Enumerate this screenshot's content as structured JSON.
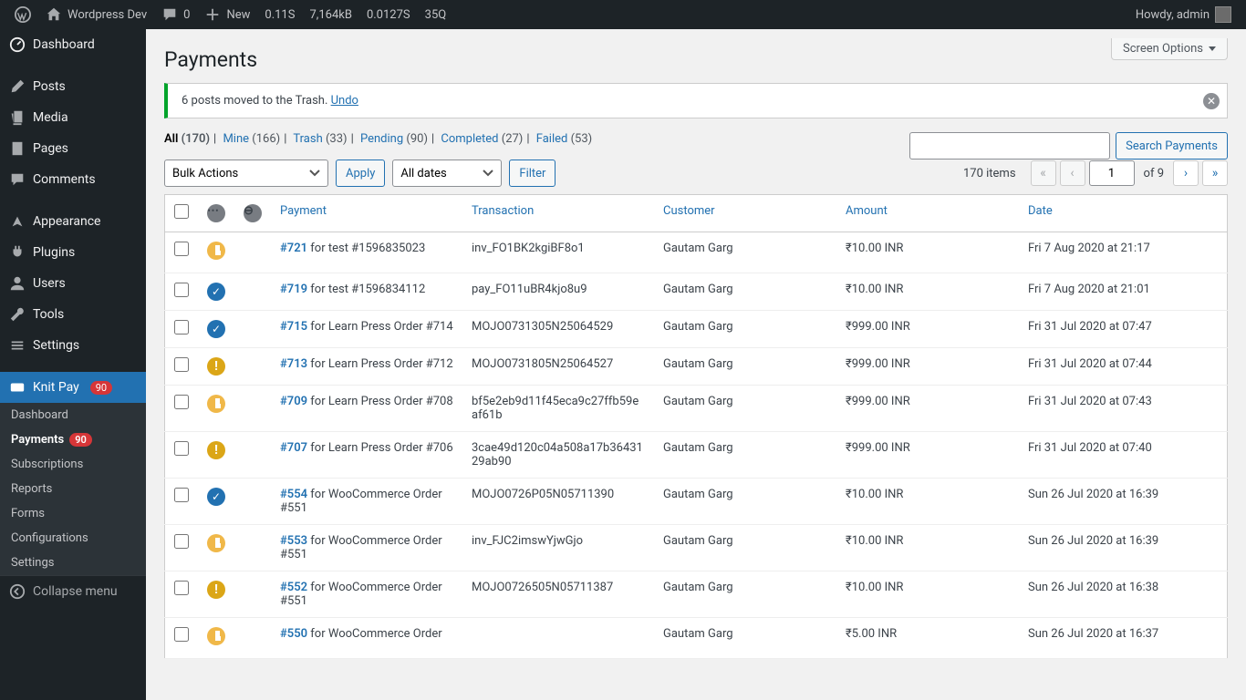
{
  "adminbar": {
    "site": "Wordpress Dev",
    "comments": "0",
    "new": "New",
    "perf1": "0.11S",
    "perf2": "7,164kB",
    "perf3": "0.0127S",
    "perf4": "35Q",
    "howdy": "Howdy, admin"
  },
  "sidebar": {
    "dashboard": "Dashboard",
    "posts": "Posts",
    "media": "Media",
    "pages": "Pages",
    "comments": "Comments",
    "appearance": "Appearance",
    "plugins": "Plugins",
    "users": "Users",
    "tools": "Tools",
    "settings": "Settings",
    "knitpay": "Knit Pay",
    "knitpay_badge": "90",
    "sub": {
      "dashboard": "Dashboard",
      "payments": "Payments",
      "payments_badge": "90",
      "subscriptions": "Subscriptions",
      "reports": "Reports",
      "forms": "Forms",
      "configurations": "Configurations",
      "settings": "Settings"
    },
    "collapse": "Collapse menu"
  },
  "screen_options": "Screen Options",
  "page_title": "Payments",
  "notice": {
    "text": "6 posts moved to the Trash. ",
    "undo": "Undo"
  },
  "views": {
    "all": "All",
    "all_c": "(170)",
    "mine": "Mine",
    "mine_c": "(166)",
    "trash": "Trash",
    "trash_c": "(33)",
    "pending": "Pending",
    "pending_c": "(90)",
    "completed": "Completed",
    "completed_c": "(27)",
    "failed": "Failed",
    "failed_c": "(53)"
  },
  "controls": {
    "bulk": "Bulk Actions",
    "apply": "Apply",
    "dates": "All dates",
    "filter": "Filter",
    "search_btn": "Search Payments",
    "items": "170 items",
    "page": "1",
    "of": "of 9"
  },
  "headers": {
    "payment": "Payment",
    "transaction": "Transaction",
    "customer": "Customer",
    "amount": "Amount",
    "date": "Date"
  },
  "rows": [
    {
      "status": "pending",
      "id": "#721",
      "for": " for test #1596835023",
      "txn": "inv_FO1BK2kgiBF8o1",
      "cust": "Gautam Garg",
      "amt": "₹10.00 INR",
      "date": "Fri 7 Aug 2020 at 21:17"
    },
    {
      "status": "completed",
      "id": "#719",
      "for": " for test #1596834112",
      "txn": "pay_FO11uBR4kjo8u9",
      "cust": "Gautam Garg",
      "amt": "₹10.00 INR",
      "date": "Fri 7 Aug 2020 at 21:01"
    },
    {
      "status": "completed",
      "id": "#715",
      "for": " for Learn Press Order #714",
      "txn": "MOJO0731305N25064529",
      "cust": "Gautam Garg",
      "amt": "₹999.00 INR",
      "date": "Fri 31 Jul 2020 at 07:47"
    },
    {
      "status": "expired",
      "id": "#713",
      "for": " for Learn Press Order #712",
      "txn": "MOJO0731805N25064527",
      "cust": "Gautam Garg",
      "amt": "₹999.00 INR",
      "date": "Fri 31 Jul 2020 at 07:44"
    },
    {
      "status": "pending",
      "id": "#709",
      "for": " for Learn Press Order #708",
      "txn": "bf5e2eb9d11f45eca9c27ffb59eaf61b",
      "cust": "Gautam Garg",
      "amt": "₹999.00 INR",
      "date": "Fri 31 Jul 2020 at 07:43"
    },
    {
      "status": "expired",
      "id": "#707",
      "for": " for Learn Press Order #706",
      "txn": "3cae49d120c04a508a17b3643129ab90",
      "cust": "Gautam Garg",
      "amt": "₹999.00 INR",
      "date": "Fri 31 Jul 2020 at 07:40"
    },
    {
      "status": "completed",
      "id": "#554",
      "for": " for WooCommerce Order #551",
      "txn": "MOJO0726P05N05711390",
      "cust": "Gautam Garg",
      "amt": "₹10.00 INR",
      "date": "Sun 26 Jul 2020 at 16:39"
    },
    {
      "status": "pending",
      "id": "#553",
      "for": " for WooCommerce Order #551",
      "txn": "inv_FJC2imswYjwGjo",
      "cust": "Gautam Garg",
      "amt": "₹10.00 INR",
      "date": "Sun 26 Jul 2020 at 16:39"
    },
    {
      "status": "expired",
      "id": "#552",
      "for": " for WooCommerce Order #551",
      "txn": "MOJO0726505N05711387",
      "cust": "Gautam Garg",
      "amt": "₹10.00 INR",
      "date": "Sun 26 Jul 2020 at 16:38"
    },
    {
      "status": "pending",
      "id": "#550",
      "for": " for WooCommerce Order",
      "txn": "",
      "cust": "Gautam Garg",
      "amt": "₹5.00 INR",
      "date": "Sun 26 Jul 2020 at 16:37"
    }
  ]
}
